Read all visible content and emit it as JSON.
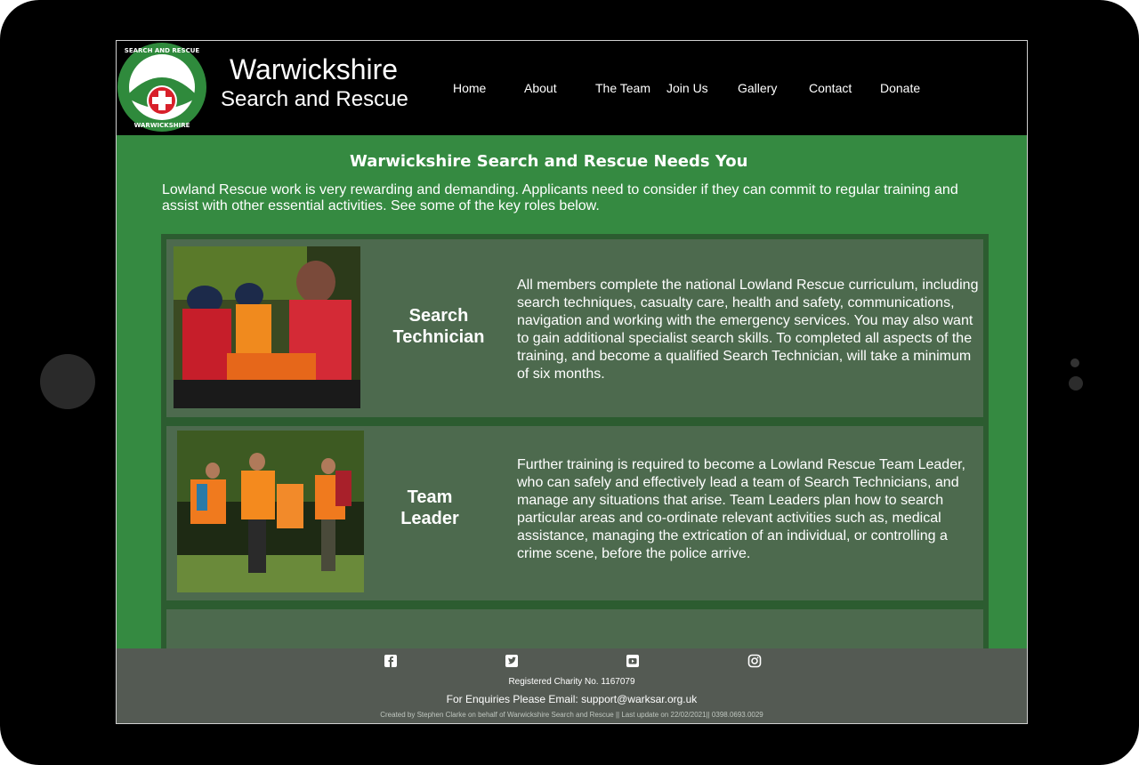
{
  "brand": {
    "title_line1": "Warwickshire",
    "title_line2": "Search and Rescue",
    "logo_text_top": "SEARCH AND RESCUE",
    "logo_text_bottom": "WARWICKSHIRE"
  },
  "nav": {
    "items": [
      {
        "label": "Home"
      },
      {
        "label": "About"
      },
      {
        "label": "The Team"
      },
      {
        "label": "Join Us"
      },
      {
        "label": "Gallery"
      },
      {
        "label": "Contact"
      },
      {
        "label": "Donate"
      }
    ]
  },
  "main": {
    "title": "Warwickshire Search and Rescue Needs You",
    "intro": "Lowland Rescue work is very rewarding and demanding. Applicants need to consider if they can commit to regular training and assist with other essential activities. See some of the key roles below.",
    "roles": [
      {
        "name_line1": "Search",
        "name_line2": "Technician",
        "description": "All members complete the national Lowland Rescue curriculum, including search techniques, casualty care, health and safety, communications, navigation and working with the emergency services. You may also want to gain additional specialist search skills.  To completed all aspects of the training, and become a qualified Search Technician, will take a minimum of six months."
      },
      {
        "name_line1": "Team",
        "name_line2": "Leader",
        "description": "Further training is required to become a Lowland Rescue Team Leader, who can safely and effectively lead a team of Search Technicians, and manage any situations that arise.  Team Leaders plan how to search particular areas and co-ordinate relevant activities such as, medical assistance, managing the extrication of an individual, or controlling a crime scene, before the police arrive."
      }
    ]
  },
  "footer": {
    "charity": "Registered Charity No. 1167079",
    "enquiries": "For Enquiries Please Email: support@warksar.org.uk",
    "credits": "Created by Stephen Clarke on behalf of Warwickshire Search and Rescue || Last update on 22/02/2021|| 0398.0693.0029",
    "social_icons": [
      "facebook-icon",
      "twitter-icon",
      "youtube-icon",
      "instagram-icon"
    ]
  },
  "colors": {
    "page_green": "#358a41",
    "card_green": "#4d6a4e",
    "header_black": "#000000",
    "footer_grey": "#545a53"
  }
}
